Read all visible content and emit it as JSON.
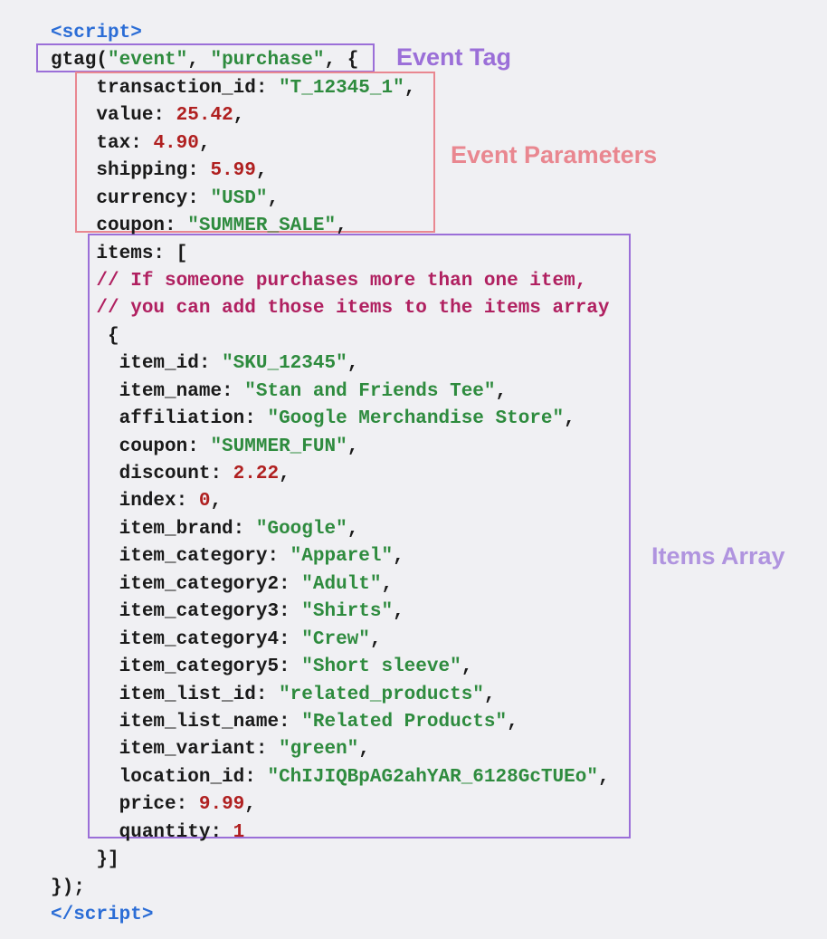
{
  "script_open": "<script>",
  "script_close": "</script>",
  "gtag_call": {
    "func": "gtag",
    "arg1": "\"event\"",
    "arg2": "\"purchase\"",
    "brace_open": "{"
  },
  "event_params": {
    "transaction_id_key": "transaction_id:",
    "transaction_id_val": "\"T_12345_1\"",
    "value_key": "value:",
    "value_val": "25.42",
    "tax_key": "tax:",
    "tax_val": "4.90",
    "shipping_key": "shipping:",
    "shipping_val": "5.99",
    "currency_key": "currency:",
    "currency_val": "\"USD\"",
    "coupon_key": "coupon:",
    "coupon_val": "\"SUMMER_SALE\""
  },
  "items_section": {
    "items_key": "items:",
    "bracket_open": "[",
    "comment1": "// If someone purchases more than one item,",
    "comment2": "// you can add those items to the items array",
    "item_brace_open": "{",
    "props": {
      "item_id_key": "item_id:",
      "item_id_val": "\"SKU_12345\"",
      "item_name_key": "item_name:",
      "item_name_val": "\"Stan and Friends Tee\"",
      "affiliation_key": "affiliation:",
      "affiliation_val": "\"Google Merchandise Store\"",
      "coupon_key": "coupon:",
      "coupon_val": "\"SUMMER_FUN\"",
      "discount_key": "discount:",
      "discount_val": "2.22",
      "index_key": "index:",
      "index_val": "0",
      "item_brand_key": "item_brand:",
      "item_brand_val": "\"Google\"",
      "item_category_key": "item_category:",
      "item_category_val": "\"Apparel\"",
      "item_category2_key": "item_category2:",
      "item_category2_val": "\"Adult\"",
      "item_category3_key": "item_category3:",
      "item_category3_val": "\"Shirts\"",
      "item_category4_key": "item_category4:",
      "item_category4_val": "\"Crew\"",
      "item_category5_key": "item_category5:",
      "item_category5_val": "\"Short sleeve\"",
      "item_list_id_key": "item_list_id:",
      "item_list_id_val": "\"related_products\"",
      "item_list_name_key": "item_list_name:",
      "item_list_name_val": "\"Related Products\"",
      "item_variant_key": "item_variant:",
      "item_variant_val": "\"green\"",
      "location_id_key": "location_id:",
      "location_id_val": "\"ChIJIQBpAG2ahYAR_6128GcTUEo\"",
      "price_key": "price:",
      "price_val": "9.99",
      "quantity_key": "quantity:",
      "quantity_val": "1"
    },
    "item_close": "}]",
    "close": "});"
  },
  "labels": {
    "event_tag": "Event Tag",
    "event_params": "Event Parameters",
    "items_array": "Items Array"
  }
}
